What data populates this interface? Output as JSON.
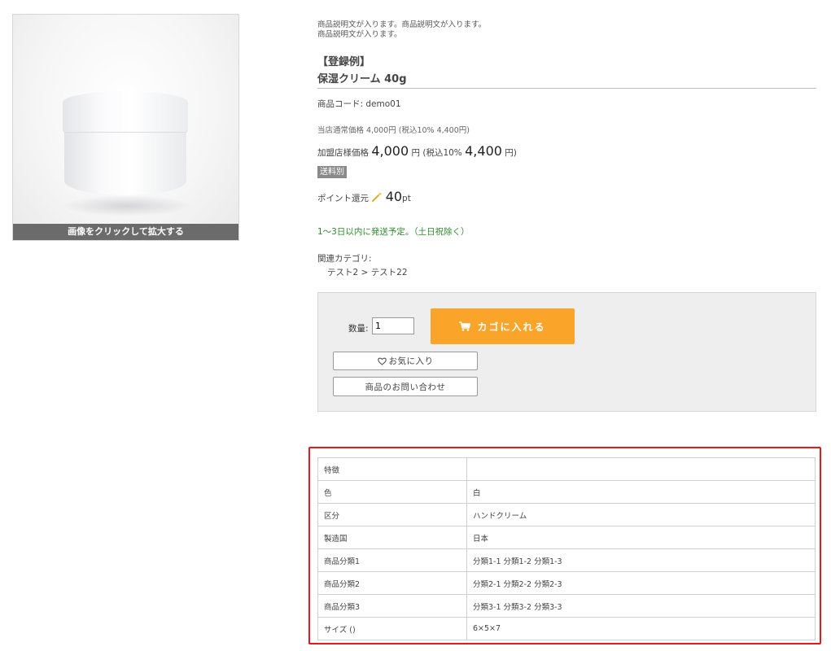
{
  "product_image": {
    "caption": "画像をクリックして拡大する"
  },
  "product": {
    "description_line1": "商品説明文が入ります。商品説明文が入ります。",
    "description_line2": "商品説明文が入ります。",
    "title_tag": "【登録例】",
    "title": "保湿クリーム 40g",
    "code_label": "商品コード:",
    "code": "demo01",
    "regular_price_text": "当店通常価格 4,000円 (税込10% 4,400円)",
    "member_price_label": "加盟店様価格",
    "member_price": "4,000",
    "yen": "円",
    "tax_label": "(税込10%",
    "tax_price": "4,400",
    "tax_suffix": "円)",
    "shipping_badge": "送料別",
    "points_label": "ポイント還元",
    "points_value": "40",
    "points_unit": "pt",
    "shipping_note": "1～3日以内に発送予定。（土日祝除く）",
    "category_label": "関連カテゴリ:",
    "category_1": "テスト2",
    "category_sep": ">",
    "category_2": "テスト22"
  },
  "cart": {
    "qty_label": "数量:",
    "qty_value": "1",
    "add_to_cart": "カゴに入れる",
    "favorite": "お気に入り",
    "inquiry": "商品のお問い合わせ"
  },
  "specs": [
    {
      "key": "特徴",
      "value": ""
    },
    {
      "key": "色",
      "value": "白"
    },
    {
      "key": "区分",
      "value": "ハンドクリーム"
    },
    {
      "key": "製造国",
      "value": "日本"
    },
    {
      "key": "商品分類1",
      "value": "分類1-1 分類1-2 分類1-3"
    },
    {
      "key": "商品分類2",
      "value": "分類2-1 分類2-2 分類2-3"
    },
    {
      "key": "商品分類3",
      "value": "分類3-1 分類3-2 分類3-3"
    },
    {
      "key": "サイズ ()",
      "value": "6×5×7"
    }
  ],
  "colors": {
    "cart_button": "#fba42a",
    "highlight_border": "#e11b1b",
    "shipping_note": "#2f8a2f",
    "badge": "#8a8a8a"
  },
  "icons": {
    "cart": "shopping-cart-icon",
    "heart": "heart-icon",
    "points": "magic-wand-icon"
  }
}
